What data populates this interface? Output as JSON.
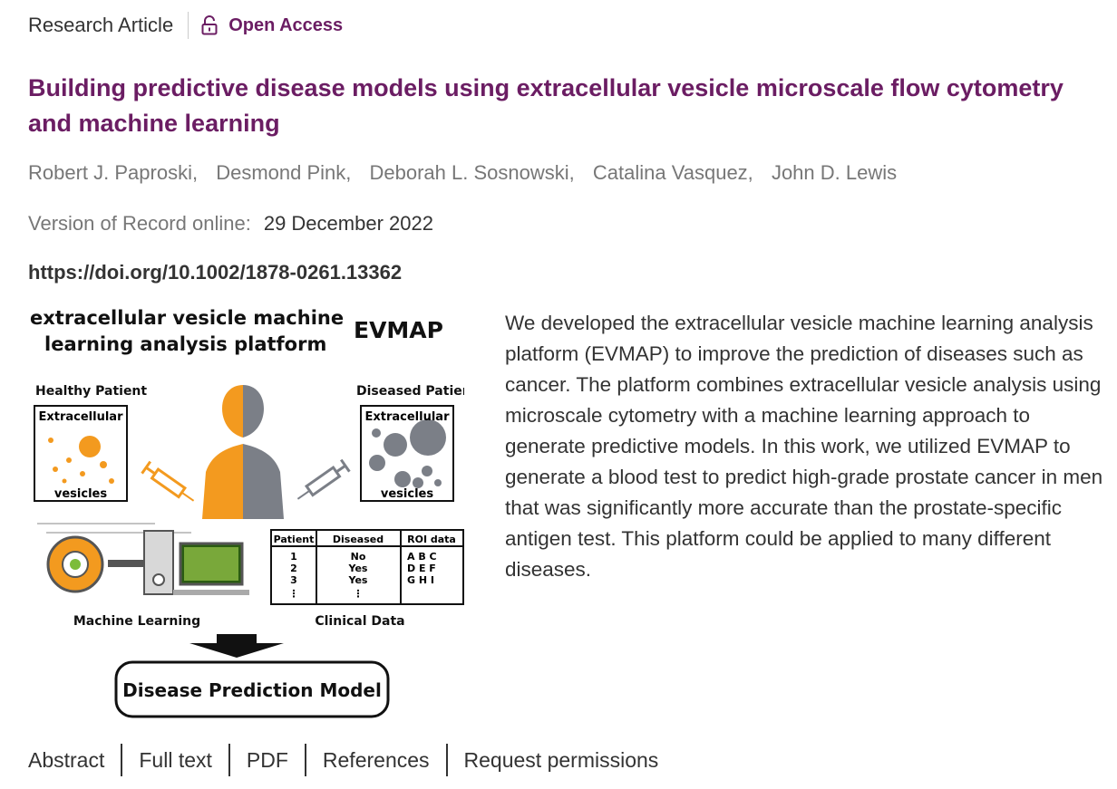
{
  "header": {
    "article_type": "Research Article",
    "open_access": "Open Access",
    "accent_color": "#6b1d63"
  },
  "article": {
    "title": "Building predictive disease models using extracellular vesicle microscale flow cytometry and machine learning",
    "authors": [
      "Robert J. Paproski,",
      "Desmond Pink,",
      "Deborah L. Sosnowski,",
      "Catalina Vasquez,",
      "John D. Lewis"
    ],
    "record_label": "Version of Record online:",
    "record_date": "29 December 2022",
    "doi": "https://doi.org/10.1002/1878-0261.13362",
    "abstract": "We developed the extracellular vesicle machine learning analysis platform (EVMAP) to improve the prediction of diseases such as cancer. The platform combines extracellular vesicle analysis using microscale cytometry with a machine learning approach to generate predictive models. In this work, we utilized EVMAP to generate a blood test to predict high-grade prostate cancer in men that was significantly more accurate than the prostate-specific antigen test. This platform could be applied to many different diseases."
  },
  "figure": {
    "title_line1": "extracellular vesicle machine",
    "title_line2": "learning analysis platform",
    "acronym": "EVMAP",
    "healthy_label": "Healthy Patient",
    "diseased_label": "Diseased Patient",
    "box_top": "Extracellular",
    "box_bottom": "vesicles",
    "table_headers": [
      "Patient",
      "Diseased",
      "ROI data"
    ],
    "table_patients": [
      "1",
      "2",
      "3",
      "⋮"
    ],
    "table_diseased": [
      "No",
      "Yes",
      "Yes",
      "⋮"
    ],
    "table_roi": [
      "A B C",
      "D E F",
      "G H I"
    ],
    "ml_label": "Machine Learning",
    "clinical_label": "Clinical Data",
    "model_label": "Disease Prediction Model",
    "orange": "#f39a1f",
    "gray": "#7b7f87"
  },
  "tabs": [
    "Abstract",
    "Full text",
    "PDF",
    "References",
    "Request permissions"
  ]
}
